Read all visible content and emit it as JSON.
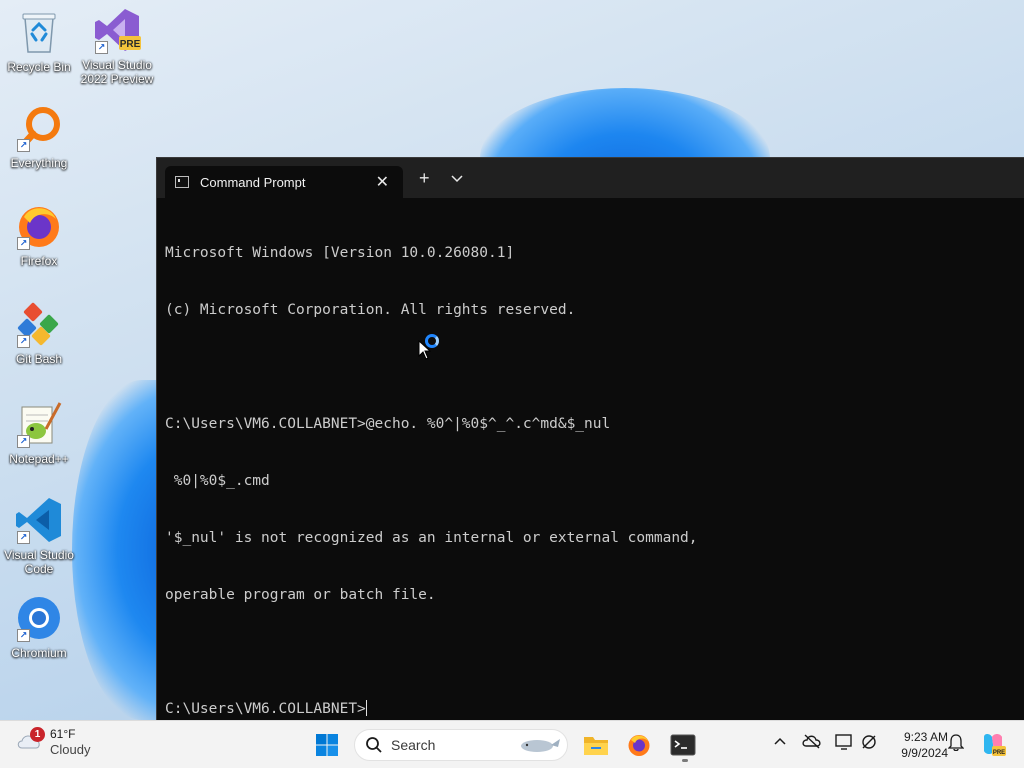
{
  "desktop": {
    "icons": [
      {
        "label": "Recycle Bin",
        "icon": "recycle-bin-icon"
      },
      {
        "label": "Visual Studio 2022 Preview",
        "icon": "visual-studio-icon",
        "badge": "PRE"
      },
      {
        "label": "Everything",
        "icon": "everything-search-icon"
      },
      {
        "label": "Firefox",
        "icon": "firefox-icon"
      },
      {
        "label": "Git Bash",
        "icon": "git-bash-icon"
      },
      {
        "label": "Notepad++",
        "icon": "notepad-plus-plus-icon"
      },
      {
        "label": "Visual Studio Code",
        "icon": "vscode-icon"
      },
      {
        "label": "Chromium",
        "icon": "chromium-icon"
      }
    ]
  },
  "terminal": {
    "tab_title": "Command Prompt",
    "lines": [
      "Microsoft Windows [Version 10.0.26080.1]",
      "(c) Microsoft Corporation. All rights reserved.",
      "",
      "C:\\Users\\VM6.COLLABNET>@echo. %0^|%0$^_^.c^md&$_nul",
      " %0|%0$_.cmd",
      "'$_nul' is not recognized as an internal or external command,",
      "operable program or batch file.",
      "",
      "C:\\Users\\VM6.COLLABNET>"
    ]
  },
  "taskbar": {
    "weather": {
      "badge": "1",
      "temp": "61°F",
      "condition": "Cloudy"
    },
    "search_placeholder": "Search",
    "clock": {
      "time": "9:23 AM",
      "date": "9/9/2024"
    },
    "pinned": [
      "start-icon",
      "file-explorer-icon",
      "firefox-icon",
      "terminal-icon"
    ],
    "tray": [
      "chevron-up-icon",
      "onedrive-icon",
      "display-icon",
      "network-icon",
      "notification-bell-icon",
      "copilot-icon"
    ]
  },
  "colors": {
    "terminal_bg": "#0c0c0c",
    "terminal_text": "#cccccc",
    "titlebar": "#202020",
    "taskbar": "#f3f3f3",
    "accent": "#0067c0"
  }
}
